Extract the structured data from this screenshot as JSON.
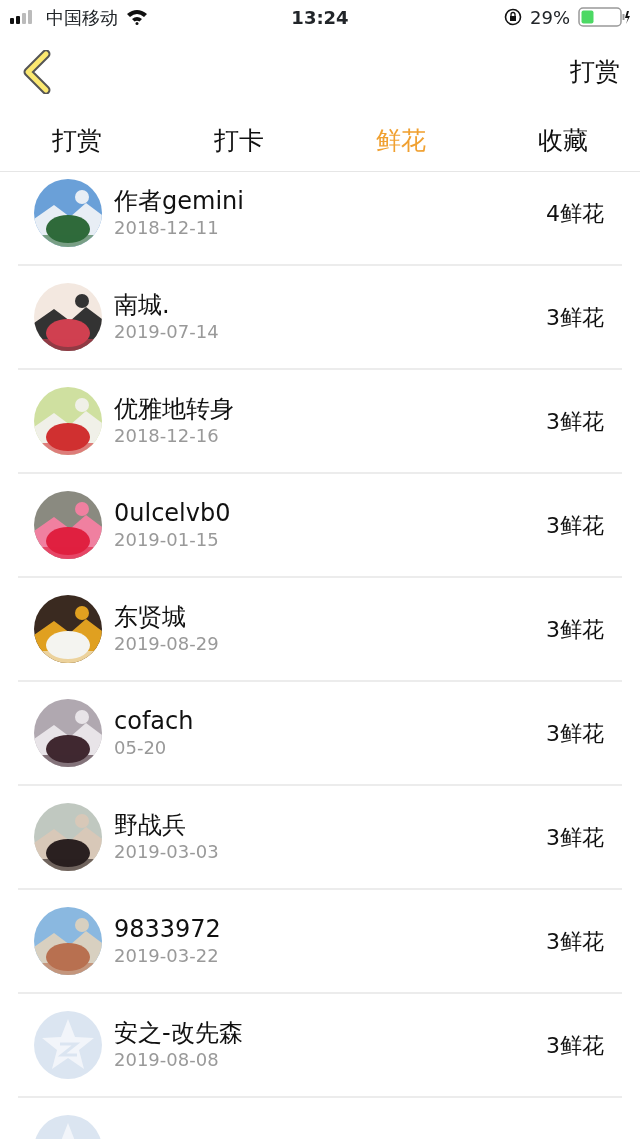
{
  "status_bar": {
    "carrier": "中国移动",
    "time": "13:24",
    "battery_percent": "29%"
  },
  "nav": {
    "action": "打赏"
  },
  "tabs": [
    {
      "label": "打赏",
      "selected": false
    },
    {
      "label": "打卡",
      "selected": false
    },
    {
      "label": "鲜花",
      "selected": true
    },
    {
      "label": "收藏",
      "selected": false
    }
  ],
  "rows": [
    {
      "name": "作者gemini",
      "date": "2018-12-11",
      "amount": "4鲜花"
    },
    {
      "name": "南城.",
      "date": "2019-07-14",
      "amount": "3鲜花"
    },
    {
      "name": "优雅地转身",
      "date": "2018-12-16",
      "amount": "3鲜花"
    },
    {
      "name": "0ulcelvb0",
      "date": "2019-01-15",
      "amount": "3鲜花"
    },
    {
      "name": "东贤城",
      "date": "2019-08-29",
      "amount": "3鲜花"
    },
    {
      "name": "cofach",
      "date": "05-20",
      "amount": "3鲜花"
    },
    {
      "name": "野战兵",
      "date": "2019-03-03",
      "amount": "3鲜花"
    },
    {
      "name": "9833972",
      "date": "2019-03-22",
      "amount": "3鲜花"
    },
    {
      "avatar": {
        "kind": "default"
      },
      "name": "安之-改先森",
      "date": "2019-08-08",
      "amount": "3鲜花"
    },
    {
      "avatar": {
        "kind": "default"
      }
    }
  ]
}
